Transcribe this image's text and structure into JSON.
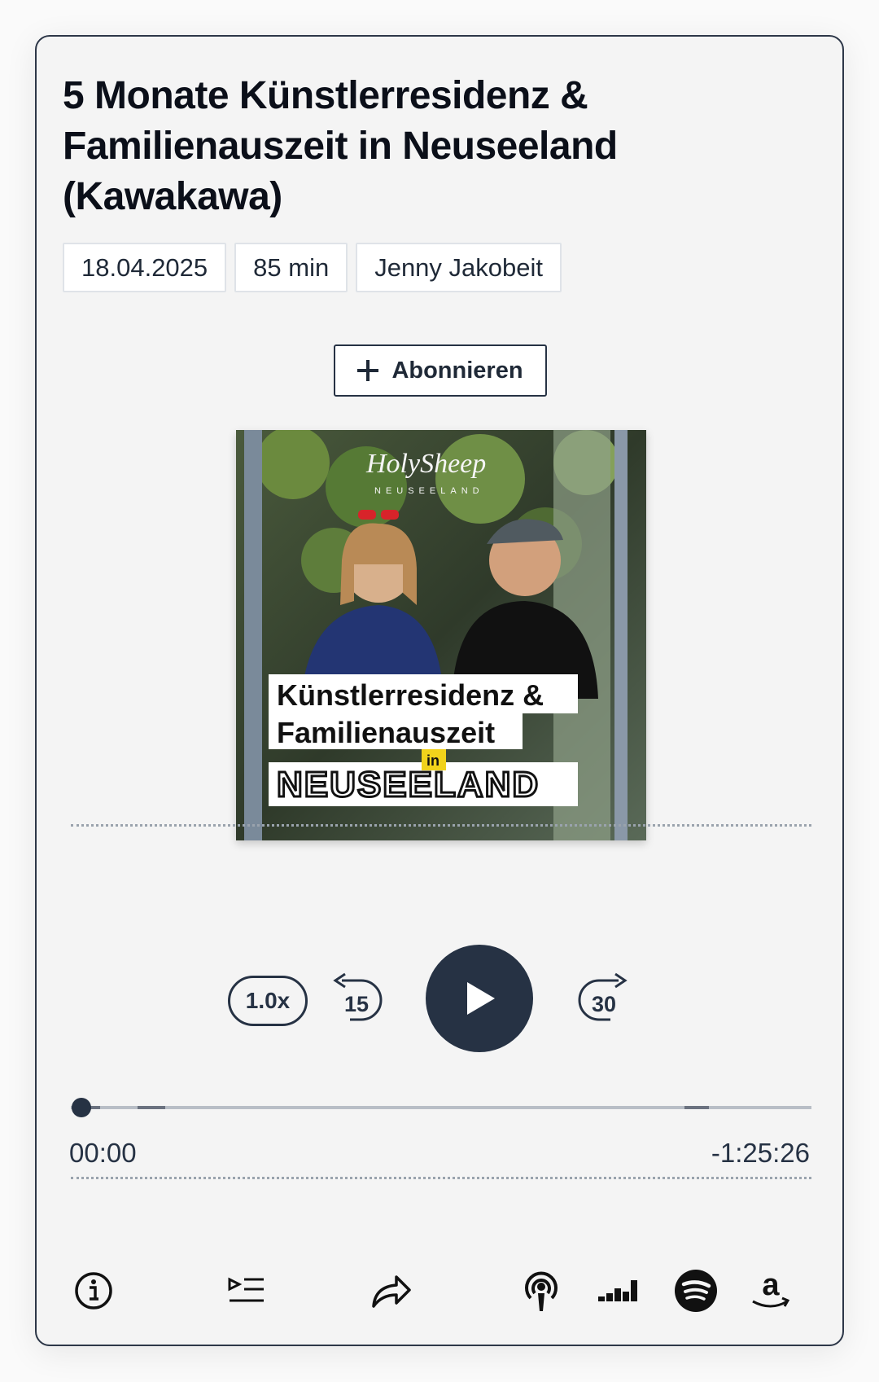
{
  "episode": {
    "title": "5 Monate Künstlerresidenz & Familienauszeit in Neuseeland (Kawakawa)",
    "date": "18.04.2025",
    "duration": "85 min",
    "author": "Jenny Jakobeit"
  },
  "subscribe": {
    "label": "Abonnieren",
    "icon": "plus-icon"
  },
  "cover": {
    "brand": "HolySheep",
    "brand_sub": "NEUSEELAND",
    "line1": "Künstlerresidenz &",
    "line2": "Familienauszeit",
    "line3": "in",
    "line4": "NEUSEELAND"
  },
  "player": {
    "speed": "1.0x",
    "rewind_seconds": "15",
    "forward_seconds": "30",
    "elapsed": "00:00",
    "remaining": "-1:25:26",
    "progress_fraction": 0.0,
    "accent_color": "#263244"
  },
  "bottom_icons": [
    "info-icon",
    "chapters-icon",
    "share-icon",
    "apple-podcasts-icon",
    "deezer-icon",
    "spotify-icon",
    "amazon-icon"
  ]
}
